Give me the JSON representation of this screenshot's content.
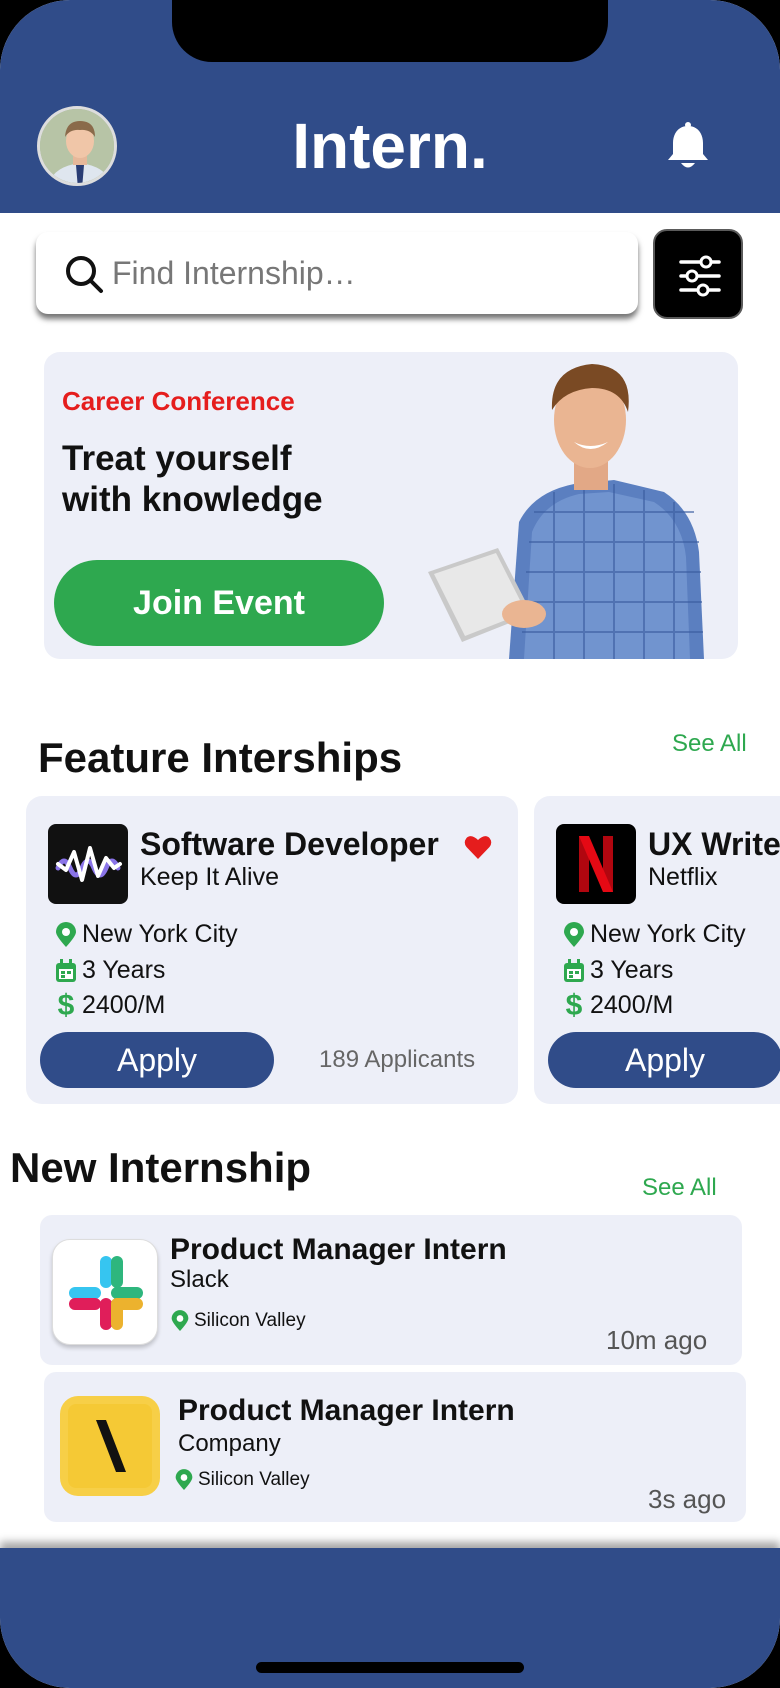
{
  "header": {
    "app_title": "Intern."
  },
  "search": {
    "placeholder": "Find Internship…"
  },
  "banner": {
    "tag": "Career Conference",
    "title": "Treat yourself with knowledge",
    "button_label": "Join Event"
  },
  "featured": {
    "section_title": "Feature Interships",
    "see_all_label": "See All",
    "cards": [
      {
        "title": "Software Developer",
        "company": "Keep It Alive",
        "location": "New York City",
        "duration": "3 Years",
        "salary": "2400/M",
        "apply_label": "Apply",
        "applicants": "189 Applicants",
        "logo_icon": "waveform-logo-icon",
        "favorited": true
      },
      {
        "title": "UX Writer",
        "company": "Netflix",
        "location": "New York City",
        "duration": "3 Years",
        "salary": "2400/M",
        "apply_label": "Apply",
        "logo_icon": "netflix-logo-icon"
      }
    ]
  },
  "new_internships": {
    "section_title": "New Internship",
    "see_all_label": "See All",
    "items": [
      {
        "title": "Product Manager Intern",
        "company": "Slack",
        "location": "Silicon Valley",
        "time": "10m ago",
        "logo_icon": "slack-logo-icon"
      },
      {
        "title": "Product Manager Intern",
        "company": "Company",
        "location": "Silicon Valley",
        "time": "3s ago",
        "logo_icon": "backslash-logo-icon"
      }
    ]
  },
  "colors": {
    "brand_blue": "#304c89",
    "accent_green": "#2ea84f",
    "tag_red": "#e51d1d",
    "card_bg": "#edeff8"
  }
}
